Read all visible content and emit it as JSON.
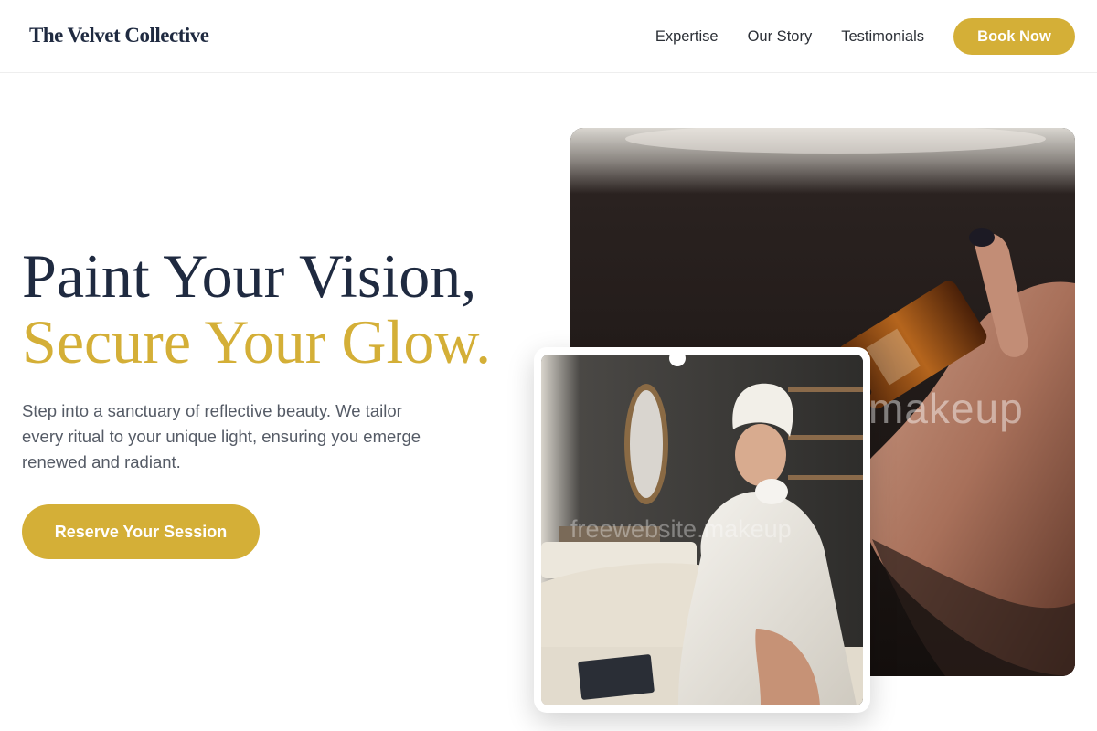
{
  "header": {
    "brand": "The Velvet Collective",
    "nav": [
      {
        "label": "Expertise"
      },
      {
        "label": "Our Story"
      },
      {
        "label": "Testimonials"
      }
    ],
    "book_label": "Book Now"
  },
  "hero": {
    "title_line1": "Paint Your Vision,",
    "title_line2": "Secure Your Glow.",
    "description": "Step into a sanctuary of reflective beauty. We tailor every ritual to your unique light, ensuring you emerge renewed and radiant.",
    "cta_label": "Reserve Your Session"
  },
  "images": {
    "back_watermark": "makeup",
    "front_watermark": "freewebsite.makeup",
    "back_icon": "serum-dropper-photo",
    "front_icon": "spa-client-photo"
  },
  "colors": {
    "accent": "#d4af37",
    "navy": "#1f2a40",
    "body_text": "#555b66"
  }
}
